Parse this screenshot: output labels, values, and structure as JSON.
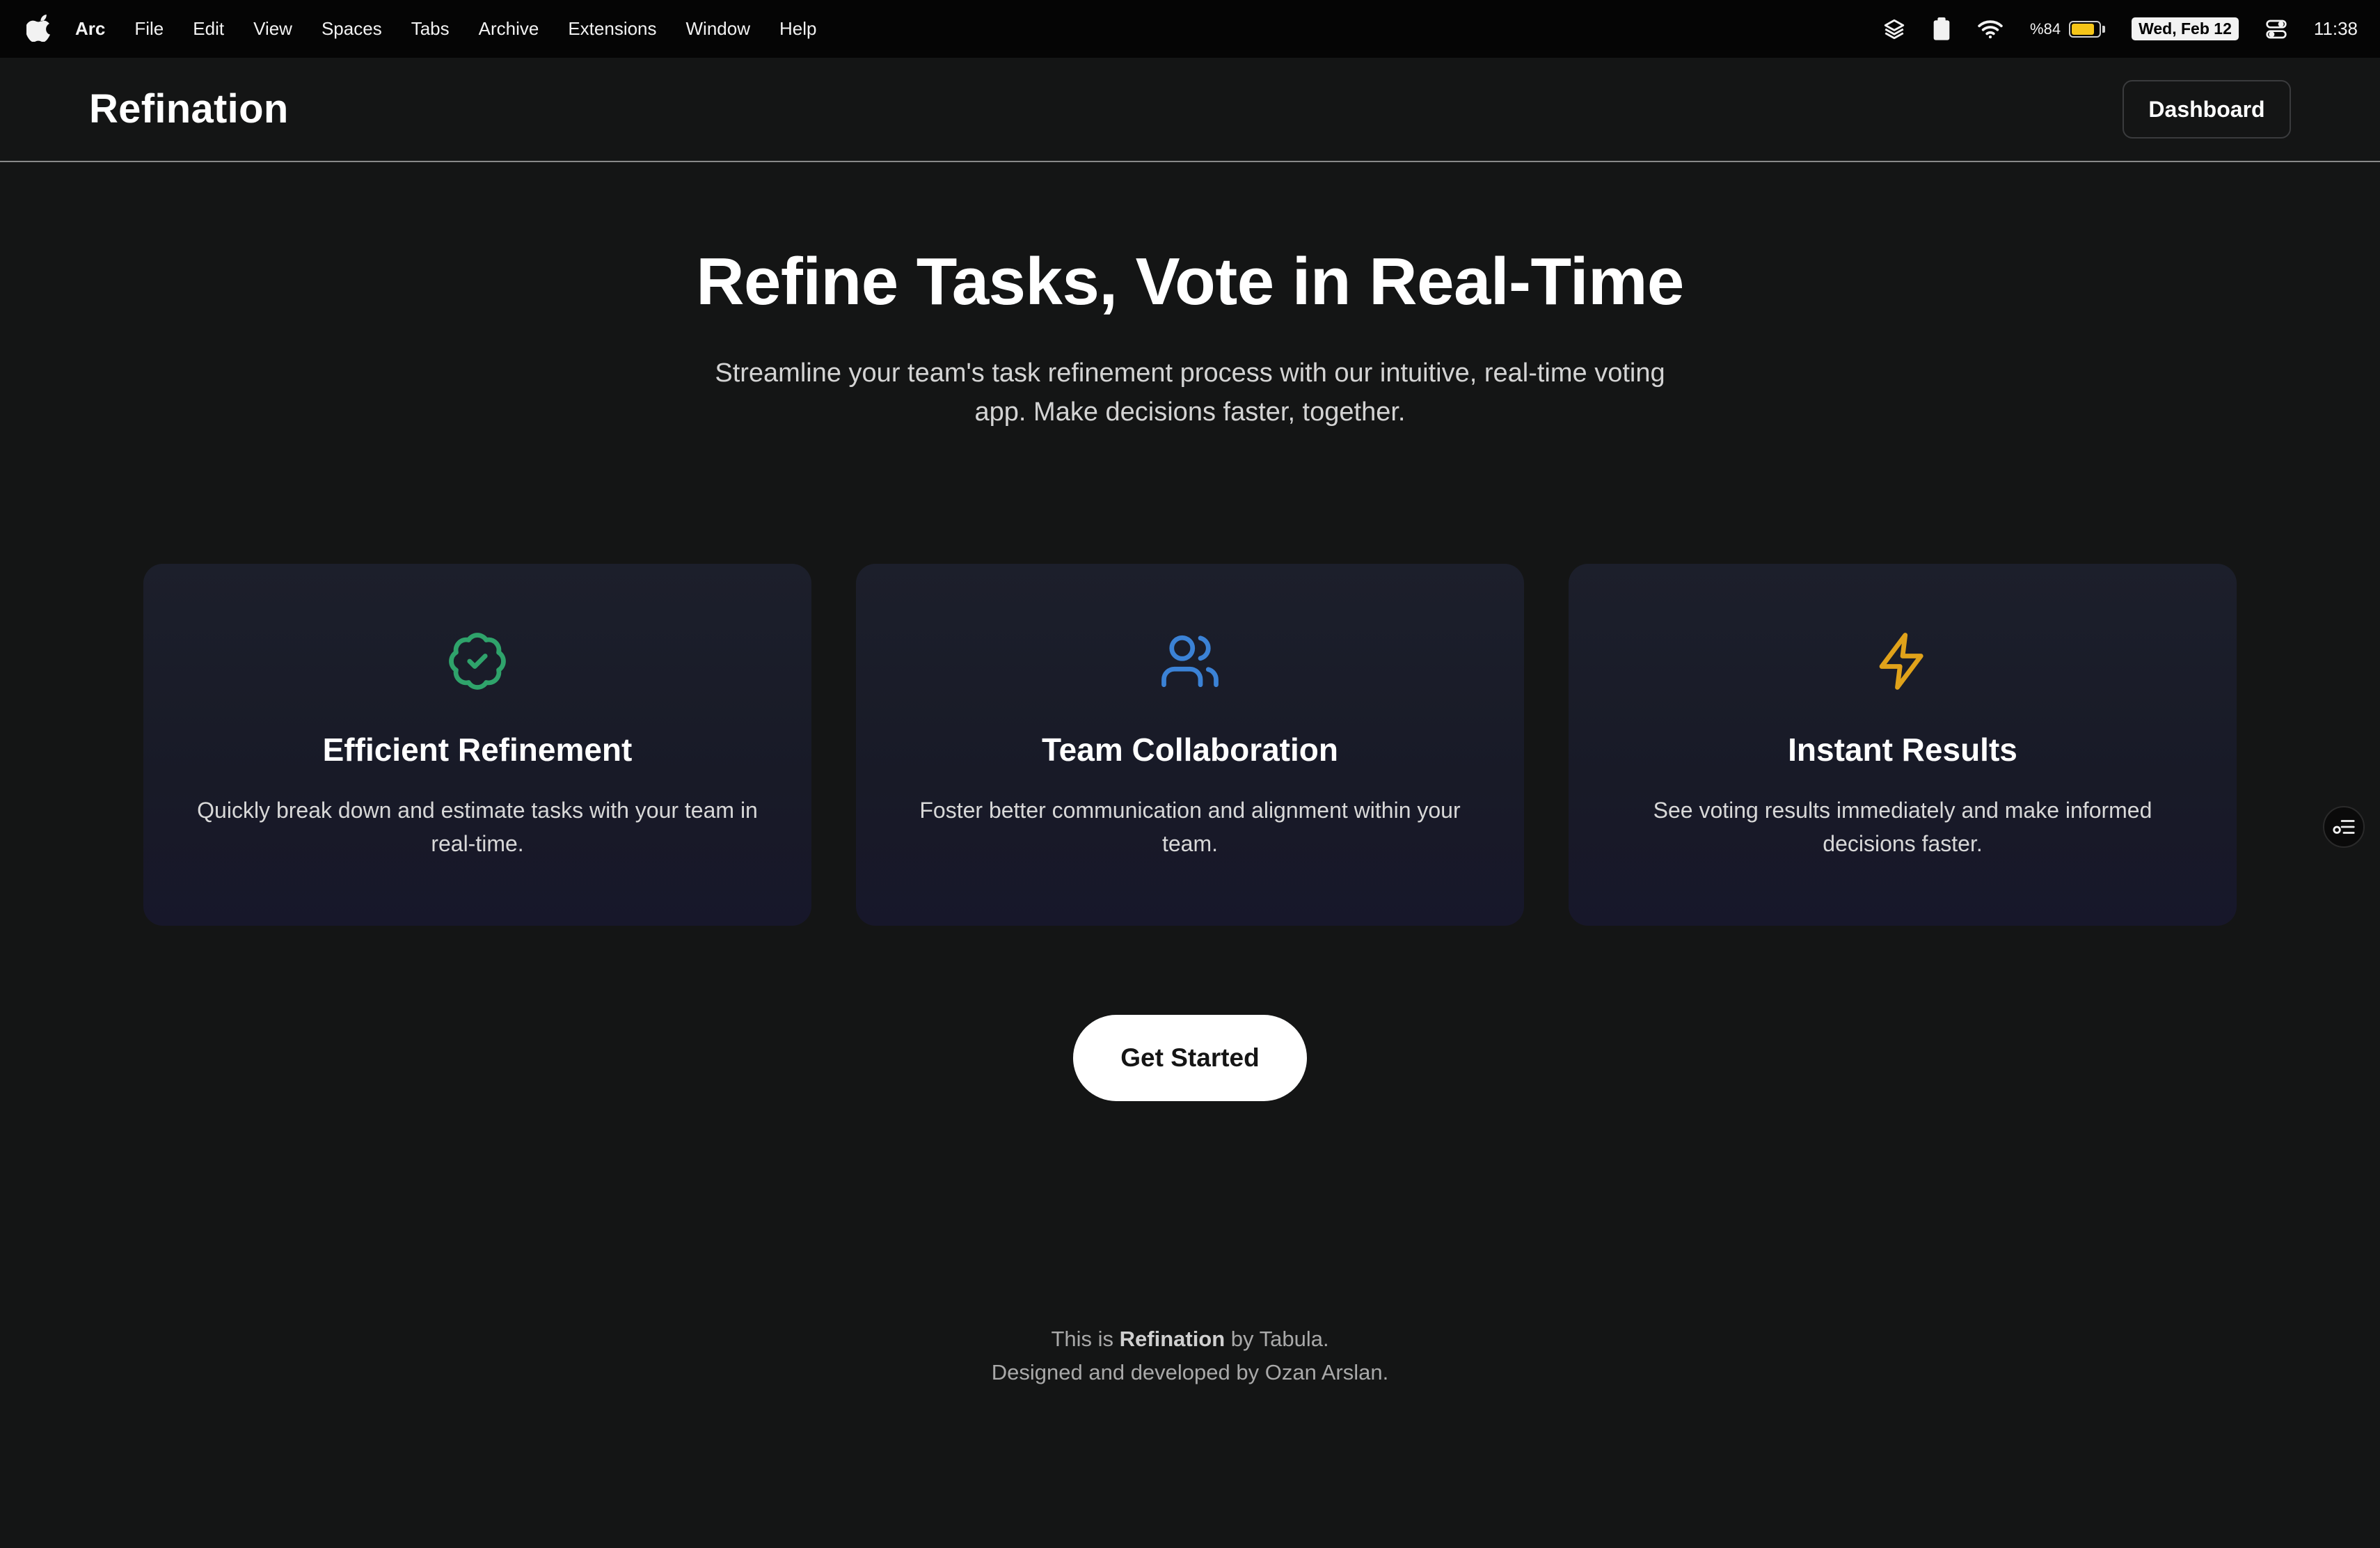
{
  "menubar": {
    "app_name": "Arc",
    "menus": [
      "File",
      "Edit",
      "View",
      "Spaces",
      "Tabs",
      "Archive",
      "Extensions",
      "Window",
      "Help"
    ],
    "battery_percent": "%84",
    "battery_level": 0.84,
    "date": "Wed, Feb 12",
    "time": "11:38"
  },
  "header": {
    "brand": "Refination",
    "dashboard_label": "Dashboard"
  },
  "hero": {
    "title": "Refine Tasks, Vote in Real-Time",
    "subtitle": "Streamline your team's task refinement process with our intuitive, real-time voting app. Make decisions faster, together."
  },
  "features": [
    {
      "icon": "badge-check-icon",
      "icon_color": "#2fa36b",
      "title": "Efficient Refinement",
      "description": "Quickly break down and estimate tasks with your team in real-time."
    },
    {
      "icon": "users-icon",
      "icon_color": "#3b82d6",
      "title": "Team Collaboration",
      "description": "Foster better communication and alignment within your team."
    },
    {
      "icon": "zap-icon",
      "icon_color": "#e0a21a",
      "title": "Instant Results",
      "description": "See voting results immediately and make informed decisions faster."
    }
  ],
  "cta": {
    "label": "Get Started"
  },
  "footer": {
    "prefix": "This is ",
    "brand": "Refination",
    "suffix": " by Tabula.",
    "credit": "Designed and developed by Ozan Arslan."
  }
}
